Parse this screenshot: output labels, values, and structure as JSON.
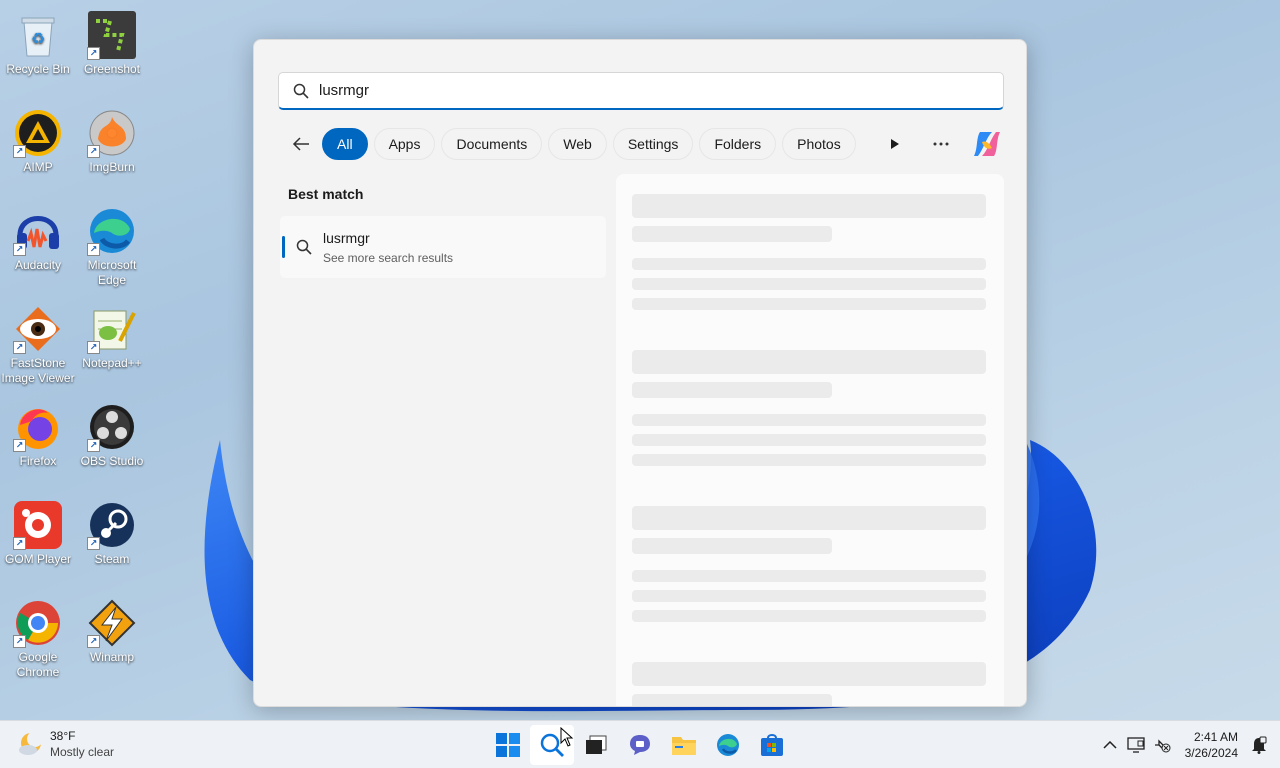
{
  "desktop": {
    "icons": [
      {
        "label": "Recycle Bin"
      },
      {
        "label": "Greenshot"
      },
      {
        "label": "AIMP"
      },
      {
        "label": "ImgBurn"
      },
      {
        "label": "Audacity"
      },
      {
        "label": "Microsoft Edge"
      },
      {
        "label": "FastStone Image Viewer"
      },
      {
        "label": "Notepad++"
      },
      {
        "label": "Firefox"
      },
      {
        "label": "OBS Studio"
      },
      {
        "label": "GOM Player"
      },
      {
        "label": "Steam"
      },
      {
        "label": "Google Chrome"
      },
      {
        "label": "Winamp"
      }
    ]
  },
  "search": {
    "query": "lusrmgr",
    "filters": [
      "All",
      "Apps",
      "Documents",
      "Web",
      "Settings",
      "Folders",
      "Photos"
    ],
    "active_filter": "All",
    "best_match_label": "Best match",
    "result": {
      "title": "lusrmgr",
      "subtitle": "See more search results"
    }
  },
  "taskbar": {
    "weather": {
      "temp": "38°F",
      "condition": "Mostly clear"
    },
    "clock": {
      "time": "2:41 AM",
      "date": "3/26/2024"
    }
  },
  "colors": {
    "accent": "#0067c0",
    "wallpaper_blue": "#1a5fe0"
  }
}
